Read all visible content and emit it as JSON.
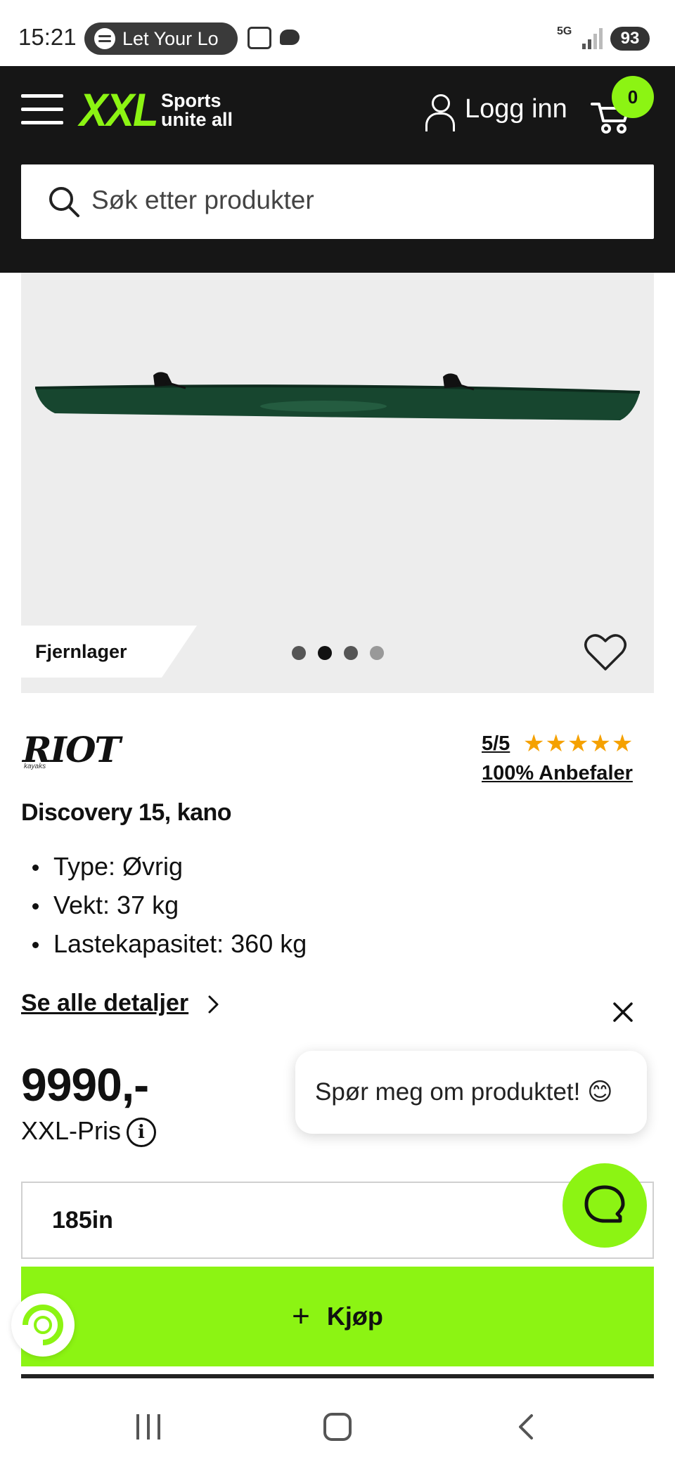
{
  "status_bar": {
    "time": "15:21",
    "media_text": "Let Your Lo",
    "network": "5G",
    "battery": "93"
  },
  "header": {
    "brand": "XXL",
    "tagline_line1": "Sports",
    "tagline_line2": "unite all",
    "login_label": "Logg inn",
    "cart_count": "0",
    "search_placeholder": "Søk etter produkter"
  },
  "gallery": {
    "stock_badge": "Fjernlager",
    "total_images": 4,
    "active_index": 1
  },
  "product": {
    "brand_logo_text": "RIOT",
    "brand_logo_sub": "kayaks",
    "rating": "5/5",
    "stars": "★★★★★",
    "recommend": "100% Anbefaler",
    "title": "Discovery 15, kano",
    "specs": [
      "Type: Øvrig",
      "Vekt: 37 kg",
      "Lastekapasitet: 360 kg"
    ],
    "details_link": "Se alle detaljer",
    "price": "9990,-",
    "price_label": "XXL-Pris",
    "info_glyph": "i",
    "size_selected": "185in",
    "buy_label": "Kjøp",
    "buy_plus": "+"
  },
  "chat": {
    "bubble_text": "Spør meg om produktet! 😊"
  },
  "colors": {
    "accent": "#8cf413",
    "header_bg": "#161616",
    "star": "#f5a100"
  }
}
